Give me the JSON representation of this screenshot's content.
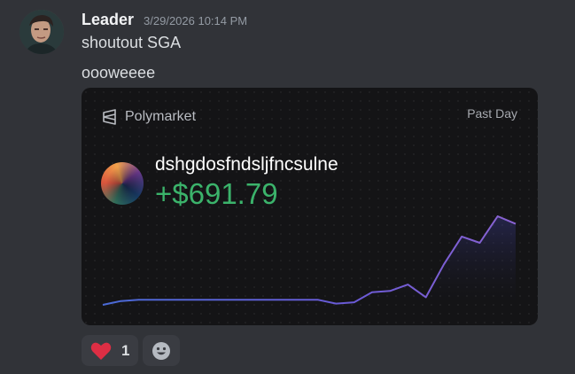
{
  "message": {
    "author": "Leader",
    "timestamp": "3/29/2026 10:14 PM",
    "lines": [
      "shoutout SGA",
      "oooweeee"
    ],
    "avatar_icon": "user-avatar-photo"
  },
  "embed": {
    "brand": "Polymarket",
    "brand_icon": "polymarket-logo-icon",
    "period": "Past Day",
    "handle": "dshgdosfndsljfncsulne",
    "pnl": "+$691.79",
    "pnl_color": "#3bb36b",
    "line_color": "#8a63d2",
    "chart_data": {
      "type": "line",
      "title": "",
      "xlabel": "",
      "ylabel": "",
      "grid": false,
      "y_unit": "USD profit",
      "x": [
        0,
        1,
        2,
        3,
        4,
        5,
        6,
        7,
        8,
        9,
        10,
        11,
        12,
        13,
        14,
        15,
        16,
        17
      ],
      "values": [
        0,
        30,
        40,
        40,
        40,
        40,
        40,
        40,
        40,
        40,
        40,
        40,
        40,
        10,
        20,
        100,
        110,
        160,
        60,
        320,
        540,
        490,
        700,
        640
      ]
    }
  },
  "reactions": [
    {
      "emoji": "heart-icon",
      "count": "1"
    }
  ],
  "add_reaction_icon": "smile-icon"
}
